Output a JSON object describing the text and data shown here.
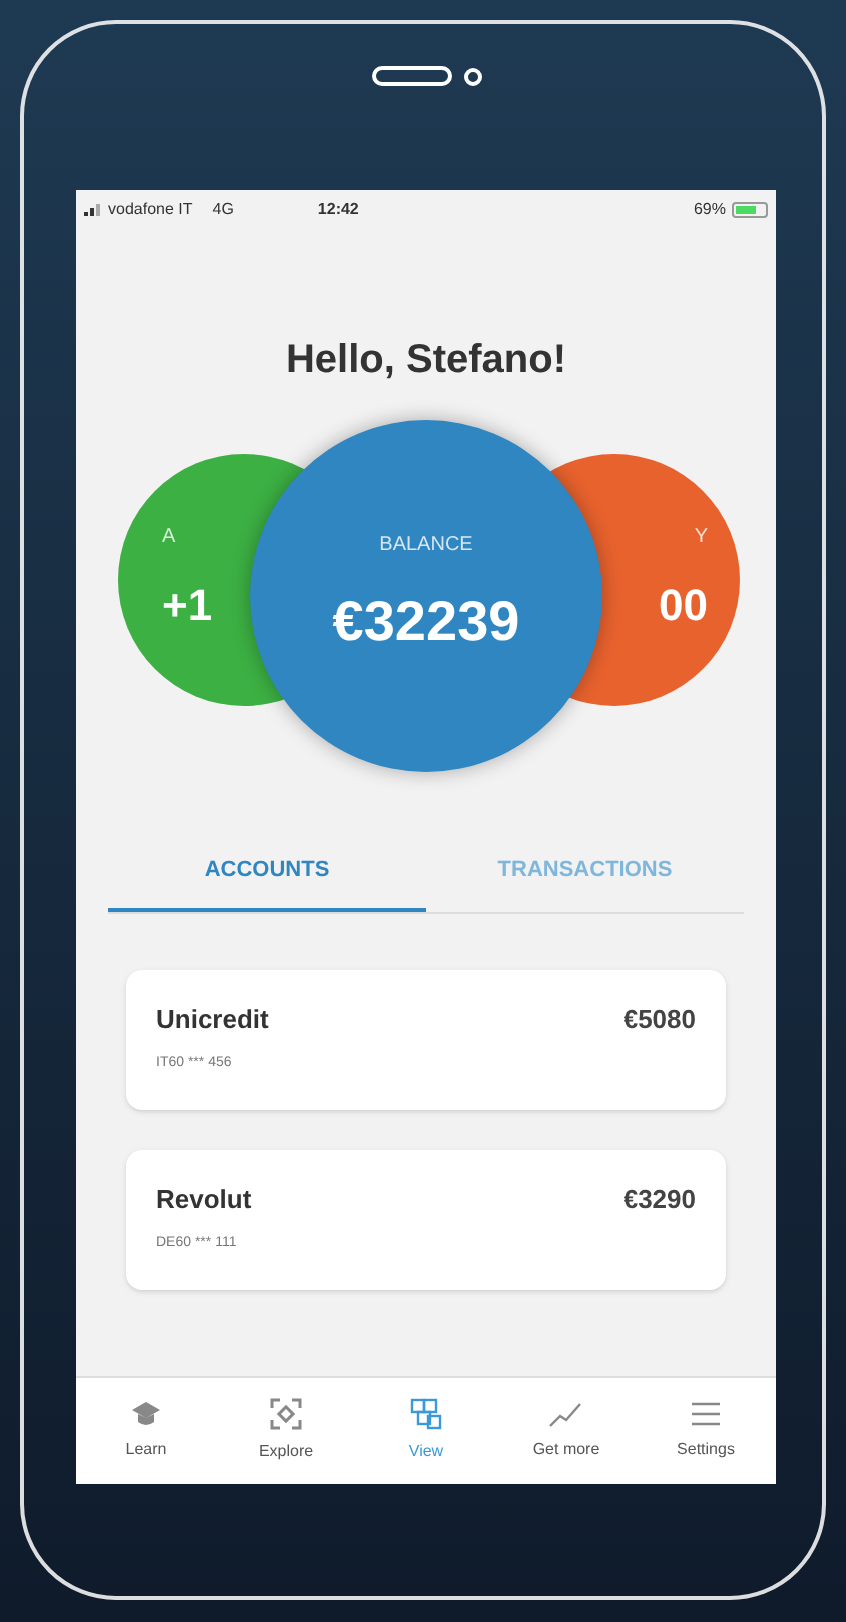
{
  "status_bar": {
    "carrier": "vodafone IT",
    "network": "4G",
    "time": "12:42",
    "battery": "69%"
  },
  "greeting": "Hello, Stefano!",
  "circles": [
    {
      "kind": "left",
      "label": "A",
      "value": "+1",
      "color": "#3cb043"
    },
    {
      "kind": "center",
      "label": "BALANCE",
      "value": "€32239",
      "color": "#2f86c0"
    },
    {
      "kind": "right",
      "label": "Y",
      "value": "00",
      "color": "#e8622e"
    }
  ],
  "tabs": [
    {
      "label": "ACCOUNTS",
      "selected": true
    },
    {
      "label": "TRANSACTIONS",
      "selected": false
    }
  ],
  "accounts": [
    {
      "name": "Unicredit",
      "iban": "IT60 *** 456",
      "amount": "€5080"
    },
    {
      "name": "Revolut",
      "iban": "DE60 *** 111",
      "amount": "€3290"
    }
  ],
  "nav": [
    {
      "kind": "learn",
      "label": "Learn",
      "selected": false
    },
    {
      "kind": "explore",
      "label": "Explore",
      "selected": false
    },
    {
      "kind": "view",
      "label": "View",
      "selected": true
    },
    {
      "kind": "getmore",
      "label": "Get more",
      "selected": false
    },
    {
      "kind": "settings",
      "label": "Settings",
      "selected": false
    }
  ]
}
